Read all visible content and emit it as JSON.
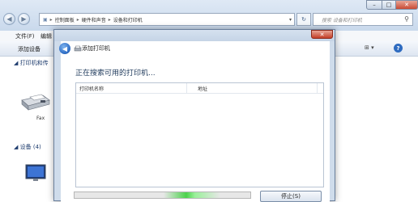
{
  "explorer": {
    "address": {
      "parts": [
        "控制面板",
        "硬件和声音",
        "设备和打印机"
      ]
    },
    "search_placeholder": "搜索 设备和打印机",
    "menu": {
      "file": "文件(F)",
      "edit": "编辑"
    },
    "command": {
      "add_device": "添加设备"
    },
    "printers_group": "打印机和传",
    "fax_label": "Fax",
    "devices_group": "设备 (4)"
  },
  "dialog": {
    "title": "添加打印机",
    "heading": "正在搜索可用的打印机...",
    "columns": {
      "name": "打印机名称",
      "address": "地址"
    },
    "progress": {
      "state": "indeterminate"
    },
    "stop_button": "停止(S)"
  },
  "colors": {
    "titlebar": "#c9d9ec",
    "close_red": "#c94a33",
    "progress_green": "#4cd24c",
    "heading_text": "#1e395b"
  }
}
